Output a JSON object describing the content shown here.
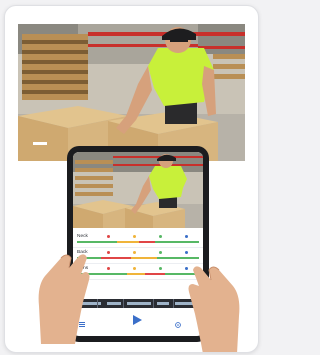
{
  "colors": {
    "card_background": "#ffffff",
    "shirt": "#c8f03a",
    "hard_hat": "#1d1d1f",
    "tablet_bezel": "#1b1c1f",
    "accent_blue": "#3b6fc9",
    "box": "#d7b57f",
    "pallet": "#b98f55",
    "rack": "#c8302b"
  },
  "screen": {
    "rows": [
      {
        "label": "Neck",
        "marker_colors": [
          "#e04646",
          "#f0b43a",
          "#57b865",
          "#3b6fc9"
        ]
      },
      {
        "label": "Back",
        "marker_colors": [
          "#e04646",
          "#f0b43a",
          "#57b865",
          "#3b6fc9"
        ]
      },
      {
        "label": "Arms",
        "marker_colors": [
          "#e04646",
          "#f0b43a",
          "#57b865",
          "#3b6fc9"
        ]
      }
    ],
    "icons": {
      "play": "play-icon",
      "left_control": "menu-icon",
      "right_control": "settings-icon"
    }
  }
}
